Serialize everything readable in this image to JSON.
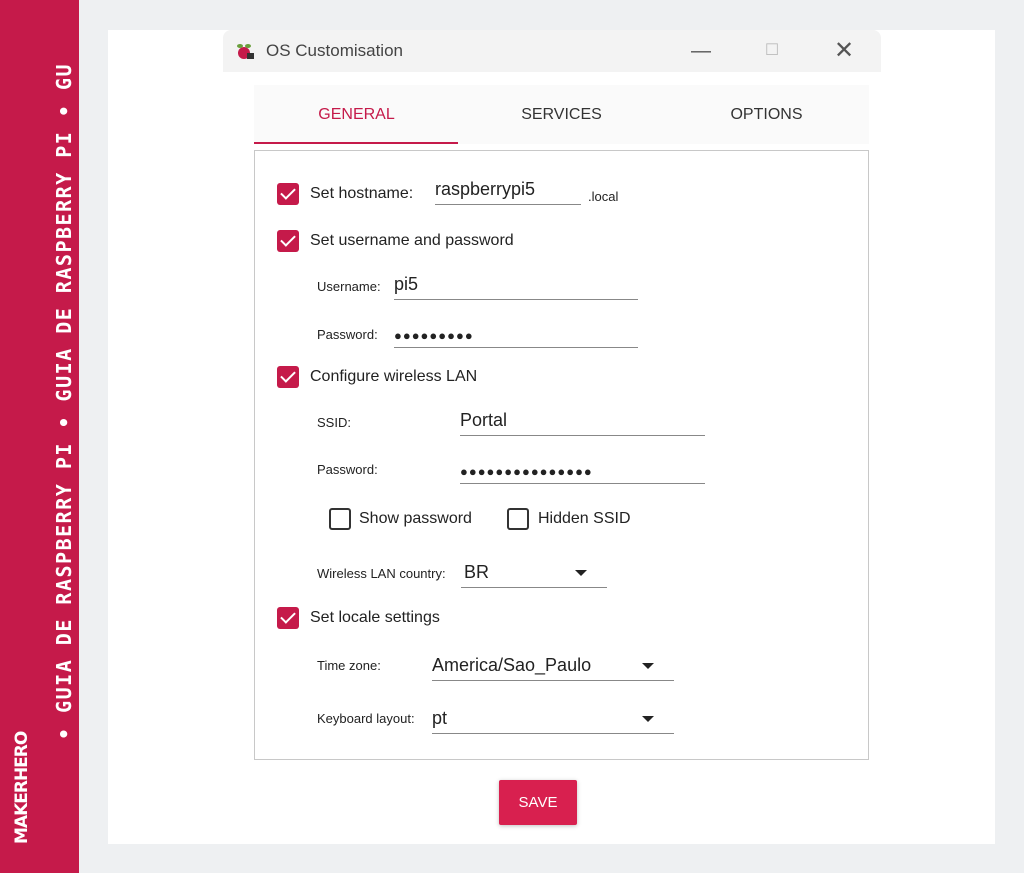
{
  "banner": {
    "text": "• GUIA DE RASPBERRY PI • GUIA DE RASPBERRY PI • GU",
    "logo": "MAKERHERO",
    "color": "#c51a4a"
  },
  "window": {
    "title": "OS Customisation",
    "icon": "raspberry-pi-icon",
    "minimize": "—",
    "maximize": "☐",
    "close": "✕"
  },
  "tabs": [
    {
      "label": "GENERAL",
      "active": true
    },
    {
      "label": "SERVICES",
      "active": false
    },
    {
      "label": "OPTIONS",
      "active": false
    }
  ],
  "general": {
    "hostname": {
      "label": "Set hostname:",
      "value": "raspberrypi5",
      "suffix": ".local",
      "checked": true
    },
    "user": {
      "label": "Set username and password",
      "checked": true,
      "username_label": "Username:",
      "username_value": "pi5",
      "password_label": "Password:",
      "password_value": "●●●●●●●●●"
    },
    "wlan": {
      "label": "Configure wireless LAN",
      "checked": true,
      "ssid_label": "SSID:",
      "ssid_value": "Portal",
      "password_label": "Password:",
      "password_value": "●●●●●●●●●●●●●●●",
      "show_password_label": "Show password",
      "show_password_checked": false,
      "hidden_ssid_label": "Hidden SSID",
      "hidden_ssid_checked": false,
      "country_label": "Wireless LAN country:",
      "country_value": "BR"
    },
    "locale": {
      "label": "Set locale settings",
      "checked": true,
      "timezone_label": "Time zone:",
      "timezone_value": "America/Sao_Paulo",
      "keyboard_label": "Keyboard layout:",
      "keyboard_value": "pt"
    }
  },
  "save_label": "SAVE",
  "accent_color": "#c51a4a"
}
